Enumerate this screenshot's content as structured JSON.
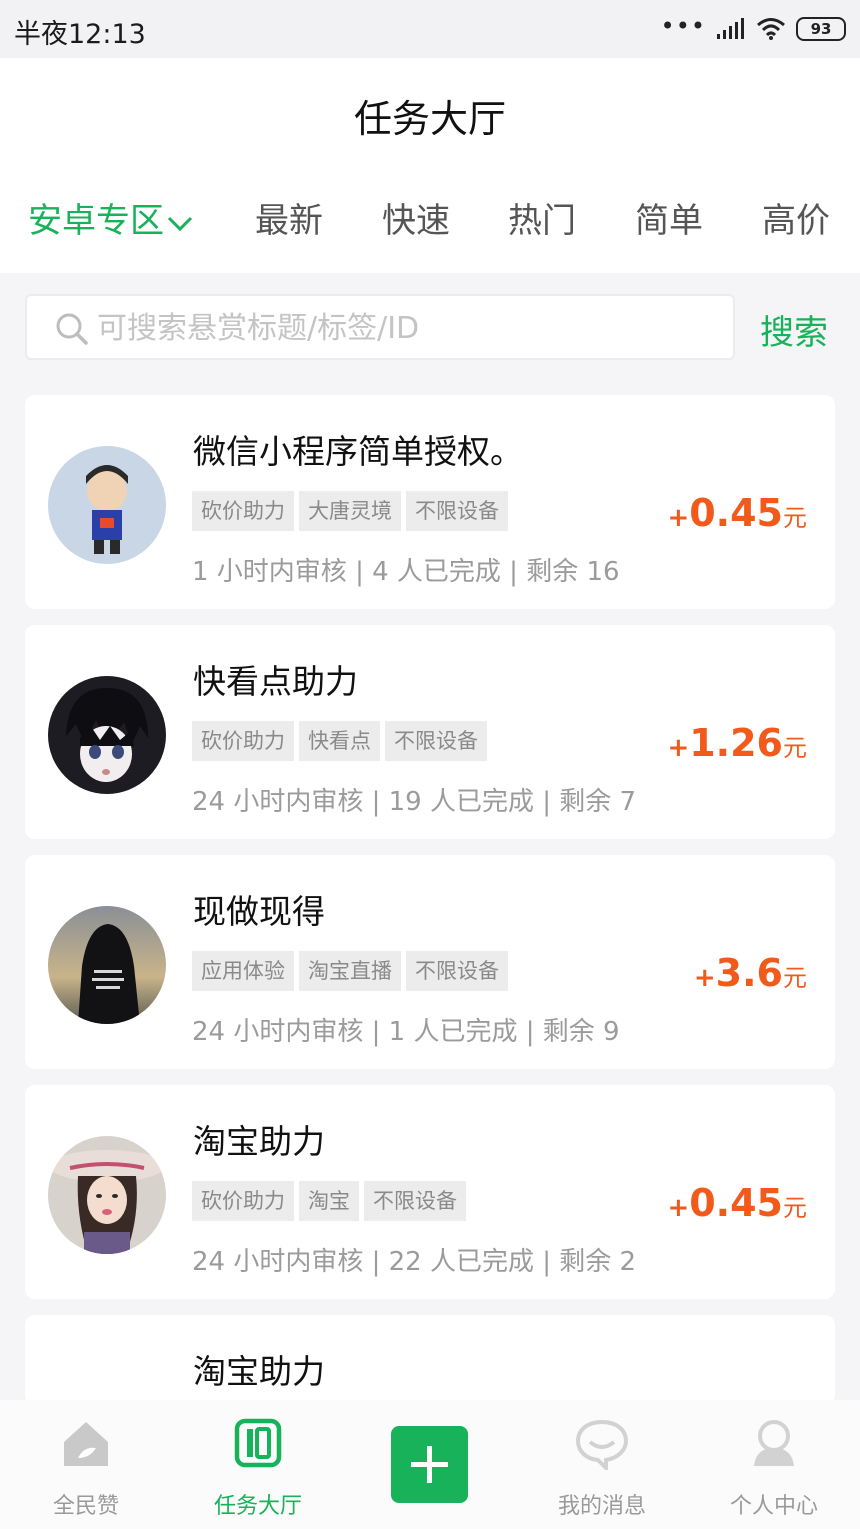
{
  "status_bar": {
    "time": "半夜12:13",
    "battery": "93"
  },
  "header": {
    "title": "任务大厅",
    "tabs": [
      {
        "label": "安卓专区"
      },
      {
        "label": "最新"
      },
      {
        "label": "快速"
      },
      {
        "label": "热门"
      },
      {
        "label": "简单"
      },
      {
        "label": "高价"
      }
    ]
  },
  "search": {
    "placeholder": "可搜索悬赏标题/标签/ID",
    "button_label": "搜索"
  },
  "tasks": [
    {
      "title": "微信小程序简单授权。",
      "tags": [
        "砍价助力",
        "大唐灵境",
        "不限设备"
      ],
      "meta": "1 小时内审核 | 4 人已完成 | 剩余 16",
      "price_sign": "+",
      "price": "0.45",
      "price_unit": "元"
    },
    {
      "title": "快看点助力",
      "tags": [
        "砍价助力",
        "快看点",
        "不限设备"
      ],
      "meta": "24 小时内审核 | 19 人已完成 | 剩余 7",
      "price_sign": "+",
      "price": "1.26",
      "price_unit": "元"
    },
    {
      "title": "现做现得",
      "tags": [
        "应用体验",
        "淘宝直播",
        "不限设备"
      ],
      "meta": "24 小时内审核 | 1 人已完成 | 剩余 9",
      "price_sign": "+",
      "price": "3.6",
      "price_unit": "元"
    },
    {
      "title": "淘宝助力",
      "tags": [
        "砍价助力",
        "淘宝",
        "不限设备"
      ],
      "meta": "24 小时内审核 | 22 人已完成 | 剩余 2",
      "price_sign": "+",
      "price": "0.45",
      "price_unit": "元"
    },
    {
      "title": "淘宝助力"
    }
  ],
  "bottom_nav": {
    "items": [
      {
        "label": "全民赞"
      },
      {
        "label": "任务大厅"
      },
      {
        "label": ""
      },
      {
        "label": "我的消息"
      },
      {
        "label": "个人中心"
      }
    ]
  },
  "colors": {
    "accent": "#18b25a",
    "price": "#f25a1c",
    "tag_bg": "#ececec"
  }
}
